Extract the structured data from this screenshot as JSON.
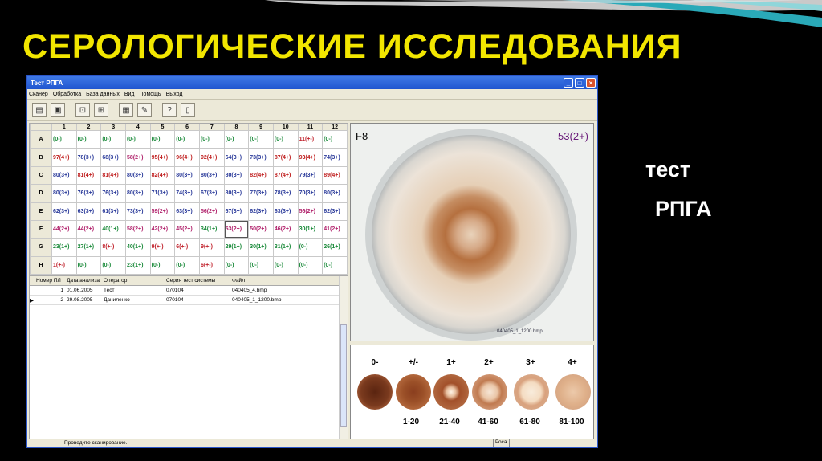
{
  "slide": {
    "title": "СЕРОЛОГИЧЕСКИЕ ИССЛЕДОВАНИЯ",
    "side_line1": "тест",
    "side_line2": "РПГА"
  },
  "window": {
    "title": "Тест РПГА",
    "menu": [
      "Сканер",
      "Обработка",
      "База данных",
      "Вид",
      "Помощь",
      "Выход"
    ]
  },
  "plate": {
    "columns": [
      "1",
      "2",
      "3",
      "4",
      "5",
      "6",
      "7",
      "8",
      "9",
      "10",
      "11",
      "12"
    ],
    "rows": [
      {
        "label": "A",
        "cells": [
          "(0-)",
          "(0-)",
          "(0-)",
          "(0-)",
          "(0-)",
          "(0-)",
          "(0-)",
          "(0-)",
          "(0-)",
          "(0-)",
          "11(+-)",
          "(0-)"
        ]
      },
      {
        "label": "B",
        "cells": [
          "97(4+)",
          "78(3+)",
          "68(3+)",
          "58(2+)",
          "95(4+)",
          "96(4+)",
          "92(4+)",
          "64(3+)",
          "73(3+)",
          "87(4+)",
          "93(4+)",
          "74(3+)"
        ]
      },
      {
        "label": "C",
        "cells": [
          "80(3+)",
          "81(4+)",
          "81(4+)",
          "80(3+)",
          "82(4+)",
          "80(3+)",
          "80(3+)",
          "80(3+)",
          "82(4+)",
          "87(4+)",
          "79(3+)",
          "89(4+)"
        ]
      },
      {
        "label": "D",
        "cells": [
          "80(3+)",
          "76(3+)",
          "76(3+)",
          "80(3+)",
          "71(3+)",
          "74(3+)",
          "67(3+)",
          "80(3+)",
          "77(3+)",
          "78(3+)",
          "70(3+)",
          "80(3+)"
        ]
      },
      {
        "label": "E",
        "cells": [
          "62(3+)",
          "63(3+)",
          "61(3+)",
          "73(3+)",
          "59(2+)",
          "63(3+)",
          "56(2+)",
          "67(3+)",
          "62(3+)",
          "63(3+)",
          "56(2+)",
          "62(3+)"
        ]
      },
      {
        "label": "F",
        "cells": [
          "44(2+)",
          "44(2+)",
          "40(1+)",
          "58(2+)",
          "42(2+)",
          "45(2+)",
          "34(1+)",
          "53(2+)",
          "50(2+)",
          "46(2+)",
          "30(1+)",
          "41(2+)"
        ]
      },
      {
        "label": "G",
        "cells": [
          "23(1+)",
          "27(1+)",
          "8(+-)",
          "40(1+)",
          "9(+-)",
          "6(+-)",
          "9(+-)",
          "29(1+)",
          "30(1+)",
          "31(1+)",
          "(0-)",
          "26(1+)"
        ]
      },
      {
        "label": "H",
        "cells": [
          "1(+-)",
          "(0-)",
          "(0-)",
          "23(1+)",
          "(0-)",
          "(0-)",
          "6(+-)",
          "(0-)",
          "(0-)",
          "(0-)",
          "(0-)",
          "(0-)"
        ]
      }
    ],
    "selected": {
      "row": 5,
      "col": 7
    }
  },
  "records": {
    "headers": [
      "Номер ПЛ",
      "Дата анализа",
      "Оператор",
      "Серия тест системы",
      "Файл"
    ],
    "rows": [
      {
        "num": "1",
        "date": "01.06.2005",
        "operator": "Тест",
        "series": "070104",
        "file": "040405_4.bmp"
      },
      {
        "num": "2",
        "date": "29.08.2005",
        "operator": "Даниленко",
        "series": "070104",
        "file": "040405_1_1200.bmp"
      }
    ]
  },
  "dish": {
    "well": "F8",
    "result": "53(2+)",
    "file": "040405_1_1200.bmp"
  },
  "scale": {
    "grades": [
      "0-",
      "+/-",
      "1+",
      "2+",
      "3+",
      "4+"
    ],
    "ranges": [
      "1-20",
      "21-40",
      "41-60",
      "61-80",
      "81-100"
    ]
  },
  "status": {
    "message": "Проведите сканирование.",
    "pane": "Роса"
  },
  "colors": {
    "title": "#f2e600",
    "grade_0": "#1a8a3a",
    "grade_pm": "#c0202a",
    "grade_1": "#1a8a3a",
    "grade_2": "#b0206a",
    "grade_3": "#2a3a9a",
    "grade_4": "#c02020"
  }
}
